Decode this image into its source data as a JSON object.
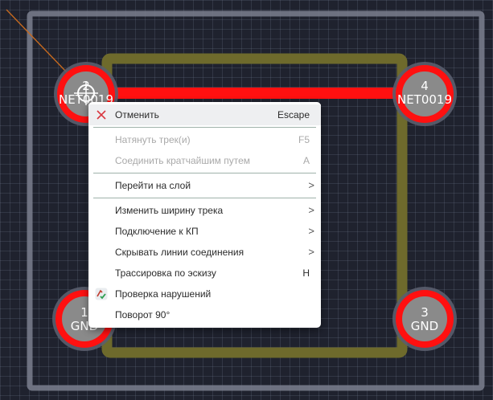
{
  "pads": [
    {
      "id": "pad-2",
      "number": "2",
      "net": "NET0019"
    },
    {
      "id": "pad-4",
      "number": "4",
      "net": "NET0019"
    },
    {
      "id": "pad-1",
      "number": "1",
      "net": "GND"
    },
    {
      "id": "pad-3",
      "number": "3",
      "net": "GND"
    }
  ],
  "colors": {
    "background": "#1f222e",
    "board_outline": "#7b7f8e",
    "track": "#ff1010",
    "ratsnest_track": "#6e6a2c",
    "pad_fill": "#8a8a8a",
    "menu_bg": "#ffffff"
  },
  "context_menu": {
    "items": [
      {
        "label": "Отменить",
        "shortcut": "Escape",
        "icon": "close-x-icon",
        "state": "hover"
      },
      {
        "label": "Натянуть трек(и)",
        "shortcut": "F5",
        "state": "disabled"
      },
      {
        "label": "Соединить кратчайшим путем",
        "shortcut": "A",
        "state": "disabled"
      },
      {
        "label": "Перейти на слой",
        "submenu": ">"
      },
      {
        "label": "Изменить ширину трека",
        "submenu": ">"
      },
      {
        "label": "Подключение к КП",
        "submenu": ">"
      },
      {
        "label": "Скрывать линии соединения",
        "submenu": ">"
      },
      {
        "label": "Трассировка по эскизу",
        "shortcut": "H"
      },
      {
        "label": "Проверка нарушений",
        "icon": "drc-check-icon"
      },
      {
        "label": "Поворот 90°"
      }
    ]
  }
}
